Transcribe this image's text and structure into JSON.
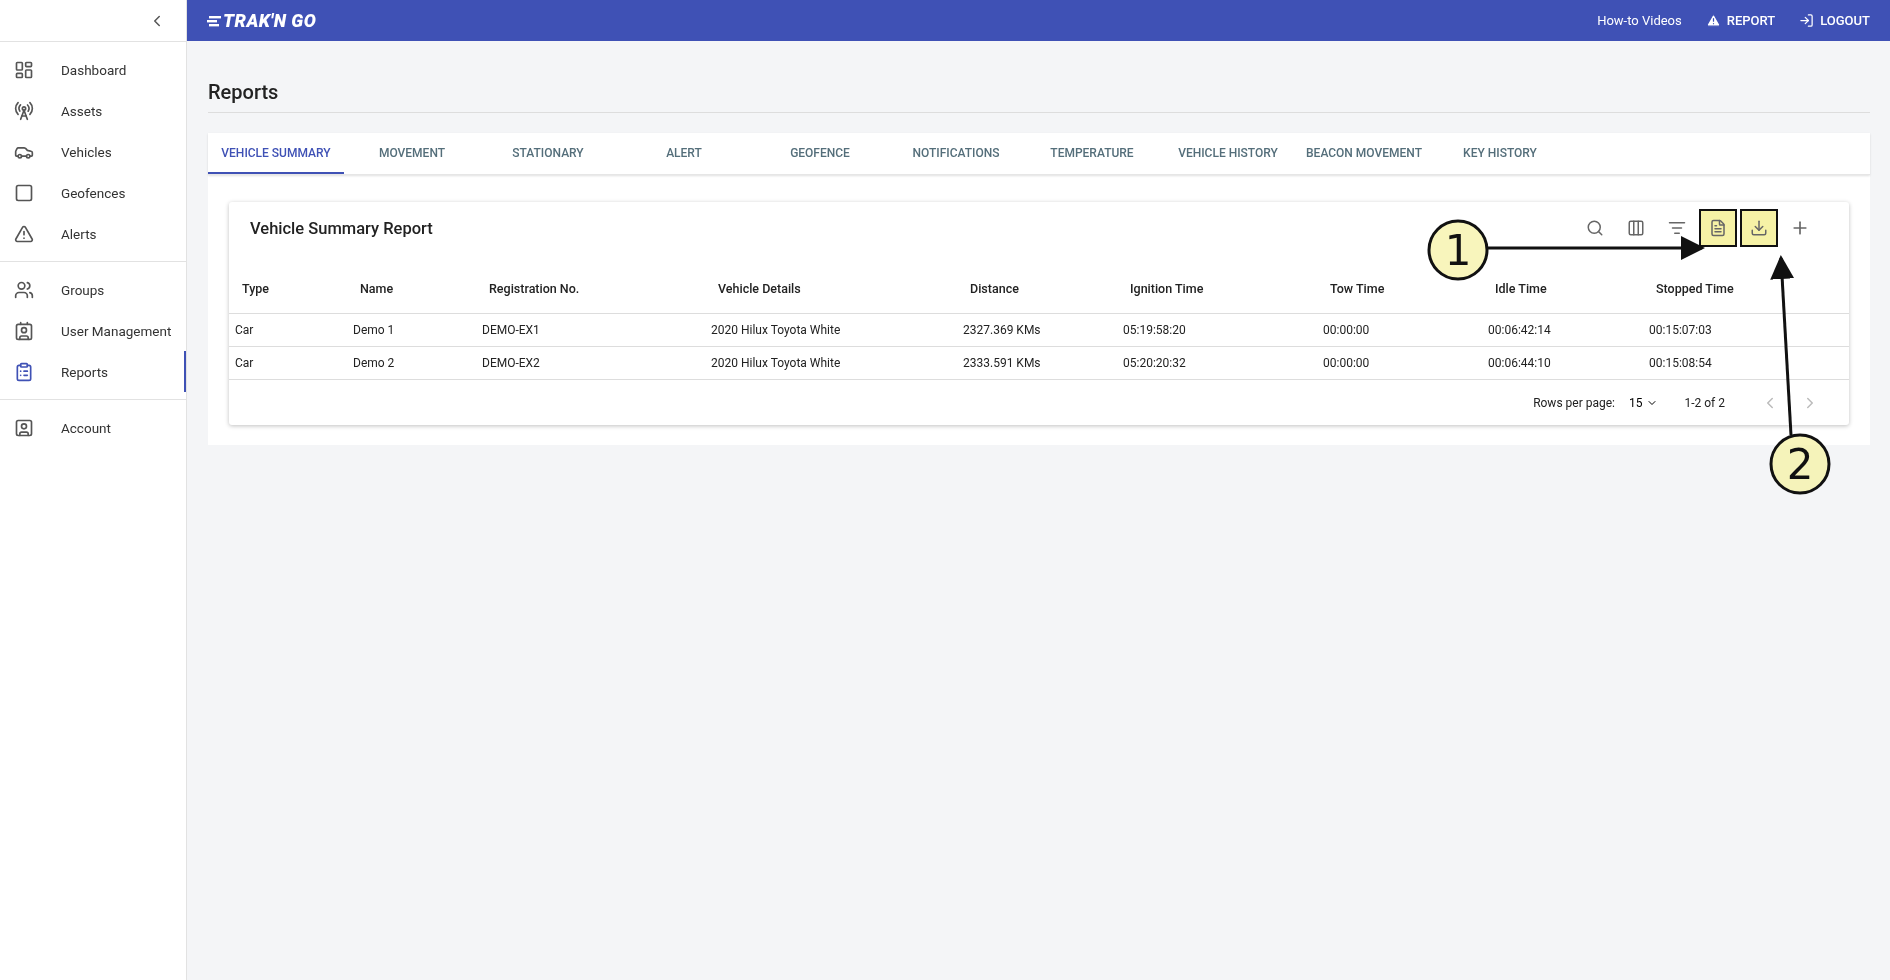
{
  "header": {
    "logo": "TRAK'N GO",
    "links": [
      {
        "label": "How-to Videos",
        "kind": "text"
      },
      {
        "label": "REPORT",
        "kind": "report"
      },
      {
        "label": "LOGOUT",
        "kind": "logout"
      }
    ]
  },
  "sidebar": {
    "sections": [
      [
        {
          "label": "Dashboard",
          "selected": false
        },
        {
          "label": "Assets",
          "selected": false
        },
        {
          "label": "Vehicles",
          "selected": false
        },
        {
          "label": "Geofences",
          "selected": false
        },
        {
          "label": "Alerts",
          "selected": false
        }
      ],
      [
        {
          "label": "Groups",
          "selected": false
        },
        {
          "label": "User Management",
          "selected": false
        },
        {
          "label": "Reports",
          "selected": true
        }
      ],
      [
        {
          "label": "Account",
          "selected": false
        }
      ]
    ]
  },
  "page": {
    "title": "Reports"
  },
  "tabs": [
    {
      "label": "VEHICLE SUMMARY",
      "selected": true
    },
    {
      "label": "MOVEMENT",
      "selected": false
    },
    {
      "label": "STATIONARY",
      "selected": false
    },
    {
      "label": "ALERT",
      "selected": false
    },
    {
      "label": "GEOFENCE",
      "selected": false
    },
    {
      "label": "NOTIFICATIONS",
      "selected": false
    },
    {
      "label": "TEMPERATURE",
      "selected": false
    },
    {
      "label": "VEHICLE HISTORY",
      "selected": false
    },
    {
      "label": "BEACON MOVEMENT",
      "selected": false
    },
    {
      "label": "KEY HISTORY",
      "selected": false
    }
  ],
  "report": {
    "title": "Vehicle Summary Report",
    "toolbar": [
      {
        "kind": "search",
        "highlighted": false
      },
      {
        "kind": "columns",
        "highlighted": false
      },
      {
        "kind": "filter",
        "highlighted": false
      },
      {
        "kind": "pdf",
        "highlighted": true
      },
      {
        "kind": "download",
        "highlighted": true
      },
      {
        "kind": "add",
        "highlighted": false
      }
    ],
    "columns": [
      "Type",
      "Name",
      "Registration No.",
      "Vehicle Details",
      "Distance",
      "Ignition Time",
      "Tow Time",
      "Idle Time",
      "Stopped Time"
    ],
    "rows": [
      [
        "Car",
        "Demo 1",
        "DEMO-EX1",
        "2020 Hilux Toyota White",
        "2327.369 KMs",
        "05:19:58:20",
        "00:00:00",
        "00:06:42:14",
        "00:15:07:03"
      ],
      [
        "Car",
        "Demo 2",
        "DEMO-EX2",
        "2020 Hilux Toyota White",
        "2333.591 KMs",
        "05:20:20:32",
        "00:00:00",
        "00:06:44:10",
        "00:15:08:54"
      ]
    ],
    "pagination": {
      "rows_per_page_label": "Rows per page:",
      "rows_per_page": "15",
      "range": "1-2 of 2"
    }
  },
  "annotations": [
    {
      "label": "1"
    },
    {
      "label": "2"
    }
  ]
}
